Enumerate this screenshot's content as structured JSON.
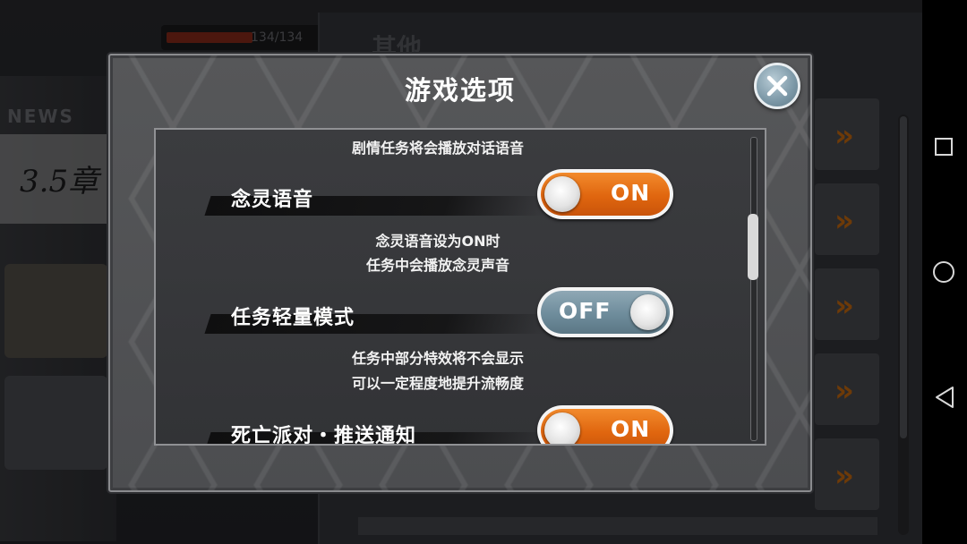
{
  "background": {
    "news_label": "NEWS",
    "chapter_label": "3.5章",
    "hp_text": "134/134",
    "section_title": "其他",
    "row_arrow": "»"
  },
  "dialog": {
    "title": "游戏选项",
    "options": [
      {
        "description_above": "剧情任务将会播放对话语音",
        "label": "念灵语音",
        "state": "ON"
      },
      {
        "description_above": [
          "念灵语音设为ON时",
          "任务中会播放念灵声音"
        ],
        "label": "任务轻量模式",
        "state": "OFF"
      },
      {
        "description_above": [
          "任务中部分特效将不会显示",
          "可以一定程度地提升流畅度"
        ],
        "label": "死亡派对・推送通知",
        "state": "ON"
      }
    ],
    "scroll_position": 0.25
  },
  "icons": {
    "close": "close-icon",
    "nav_recents": "square-icon",
    "nav_home": "circle-icon",
    "nav_back": "triangle-back-icon"
  },
  "colors": {
    "toggle_on": "#e66a10",
    "toggle_off": "#6e8c9b",
    "close_button": "#7b97a6"
  }
}
